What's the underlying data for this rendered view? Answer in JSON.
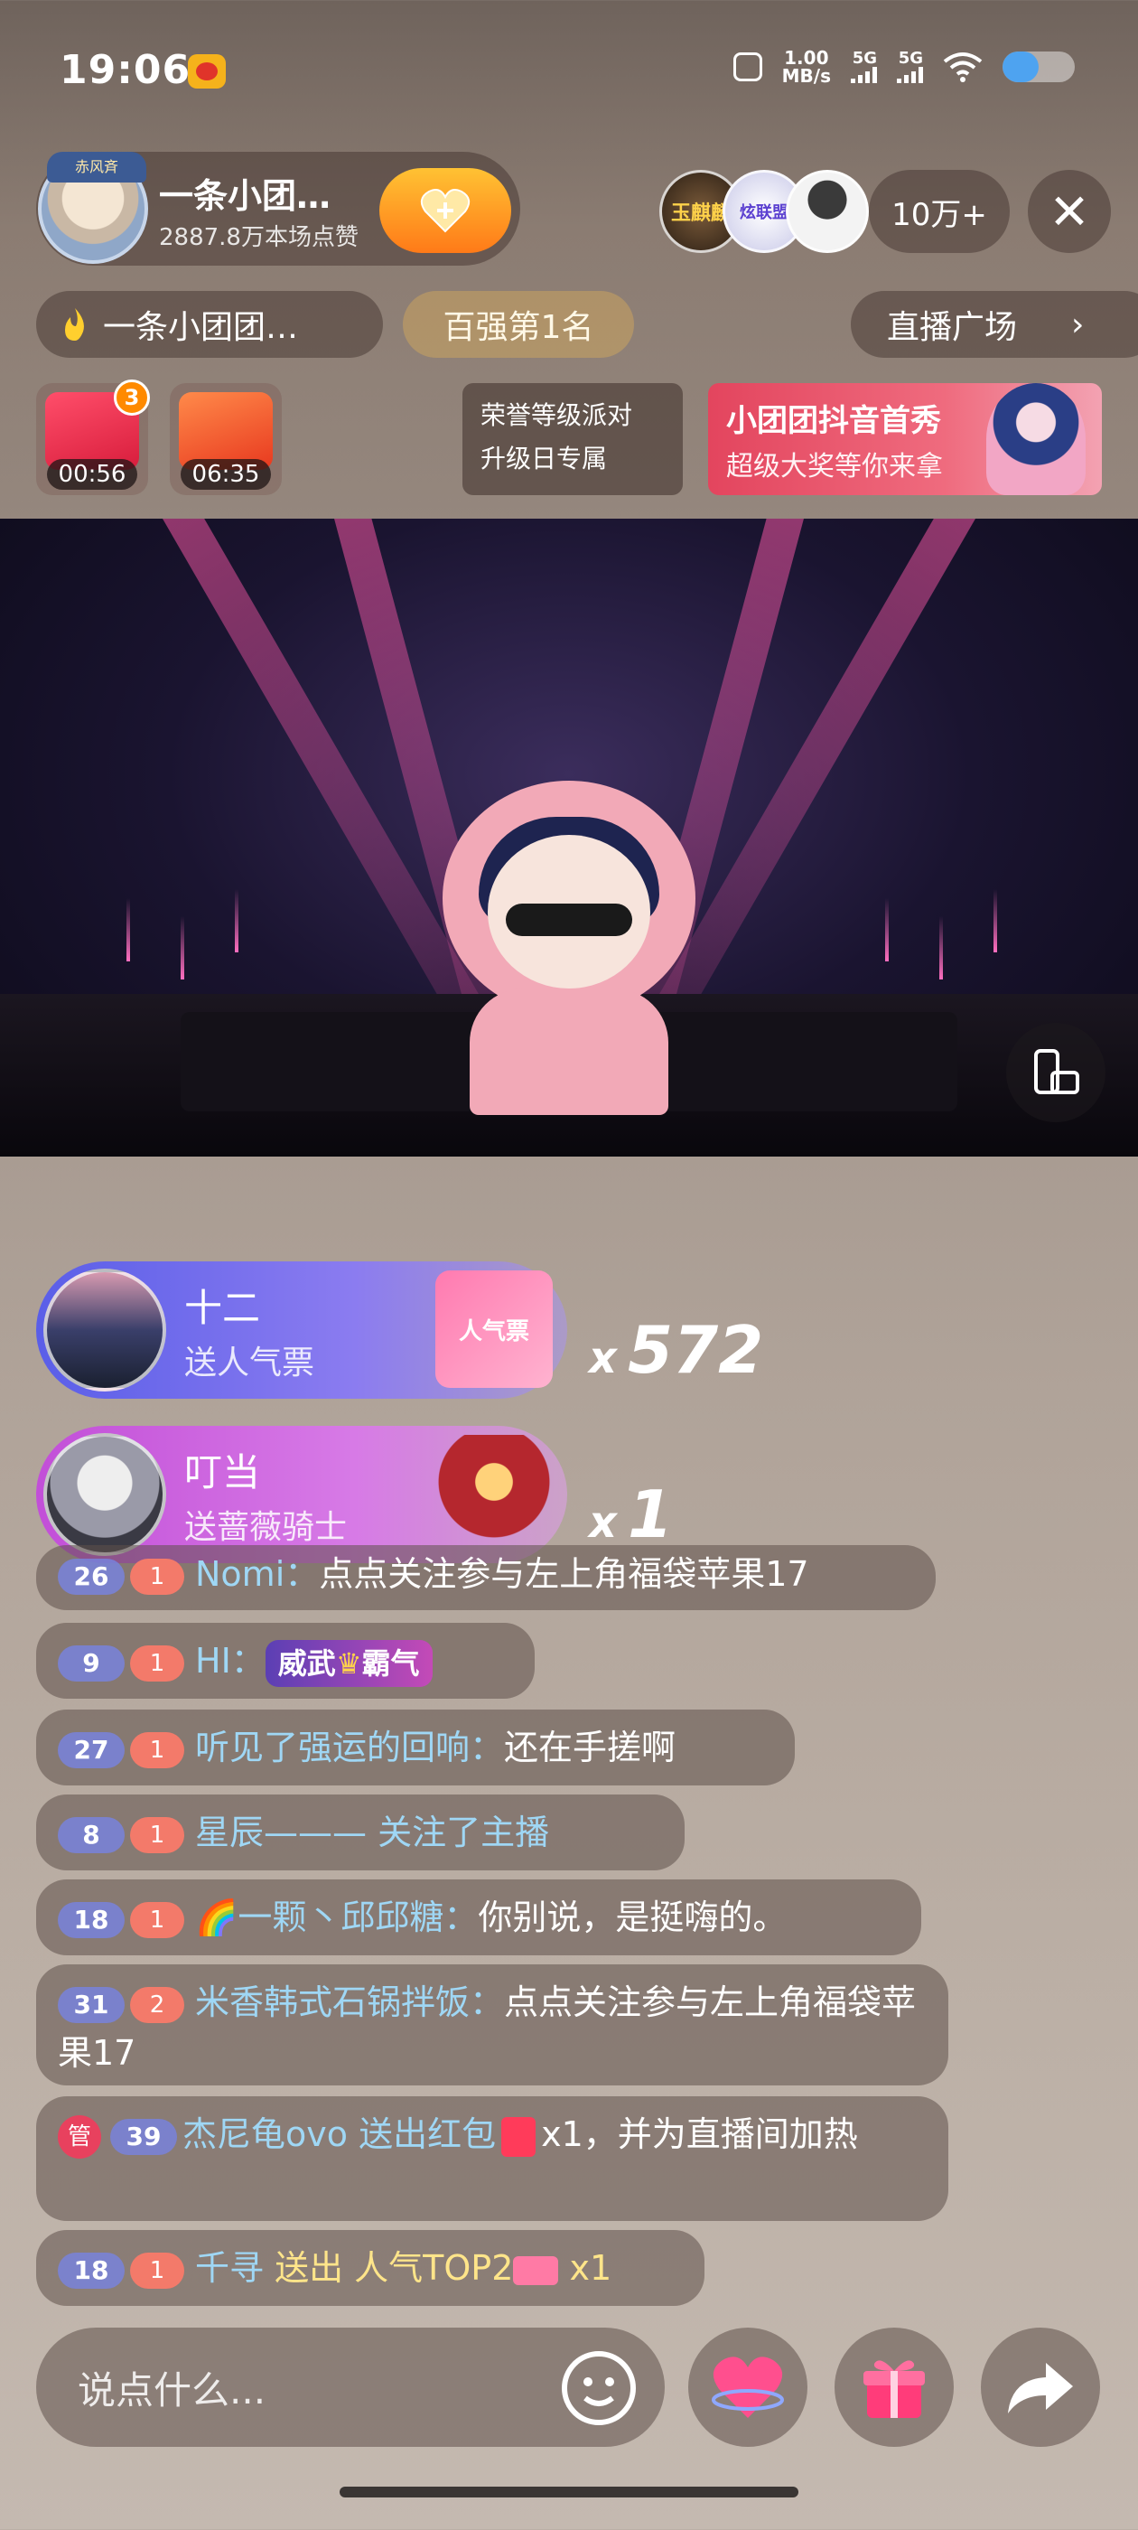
{
  "status_bar": {
    "time": "19:06",
    "net_speed_value": "1.00",
    "net_speed_unit": "MB/s",
    "sim1": "5G",
    "sim2": "5G",
    "battery_level": 0.5
  },
  "anchor": {
    "name": "一条小团…",
    "likes": "2887.8万本场点赞",
    "avatar_crown": "赤风斉"
  },
  "viewers": {
    "avatars": [
      "玉麒麟",
      "炫联盟",
      ""
    ],
    "count": "10万+"
  },
  "row2": {
    "fan_club": "一条小团团…",
    "rank": "百强第1名",
    "plaza": "直播广场"
  },
  "activities": {
    "redbag1_timer": "00:56",
    "redbag1_badge": "3",
    "redbag2_timer": "06:35",
    "honor_line1": "荣誉等级派对",
    "honor_line2": "升级日专属",
    "banner_line1": "小团团抖音首秀",
    "banner_line2": "超级大奖等你来拿"
  },
  "gifts": [
    {
      "name": "十二",
      "desc": "送人气票",
      "gift_label": "人气票",
      "count": "572",
      "x": "x"
    },
    {
      "name": "叮当",
      "desc": "送蔷薇骑士",
      "count": "1",
      "x": "x"
    }
  ],
  "chat": [
    {
      "level": "26",
      "fan_level": "1",
      "user": "Nomi：",
      "text": "点点关注参与左上角福袋苹果17"
    },
    {
      "level": "9",
      "fan_level": "1",
      "user": "HI：",
      "tag_a": "威武",
      "tag_b": "霸气"
    },
    {
      "level": "27",
      "fan_level": "1",
      "user": "听见了强运的回响：",
      "text": "还在手搓啊"
    },
    {
      "level": "8",
      "fan_level": "1",
      "user": "星辰——— 关注了主播",
      "text": ""
    },
    {
      "level": "18",
      "fan_level": "1",
      "user": "🌈一颗丶邱邱糖：",
      "text": "你别说，是挺嗨的。"
    },
    {
      "level": "31",
      "fan_level": "2",
      "user": "米香韩式石锅拌饭：",
      "text": "点点关注参与左上角福袋苹果17"
    },
    {
      "badge": "管",
      "level": "39",
      "user": "杰尼龟ovo 送出红包",
      "text": "x1，并为直播间加热"
    },
    {
      "level": "18",
      "fan_level": "1",
      "user": "千寻",
      "text_a": " 送出 人气TOP2",
      "text_b": " x1"
    }
  ],
  "bottom": {
    "input_placeholder": "说点什么..."
  },
  "colors": {
    "accent_orange": "#ff7a18",
    "gift_purple": "#5a5ee8",
    "gift_magenta": "#c24fd8",
    "username_blue": "#9fd7f5"
  }
}
